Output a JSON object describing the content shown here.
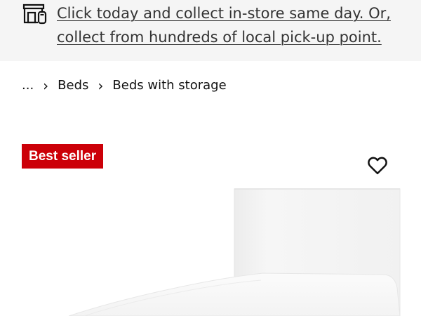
{
  "banner": {
    "icon": "store-pickup-icon",
    "text": "Click today and collect in-store same day. Or, collect from hundreds of local pick-up point."
  },
  "breadcrumb": {
    "items": [
      {
        "label": "..."
      },
      {
        "label": "Beds"
      },
      {
        "label": "Beds with storage"
      }
    ],
    "separator_icon": "chevron-right-icon"
  },
  "product": {
    "badge": "Best seller",
    "favorite_icon": "heart-icon",
    "image_icon": "bed-image"
  },
  "colors": {
    "banner_bg": "#f5f5f5",
    "badge_bg": "#cc0008",
    "badge_text": "#ffffff",
    "text": "#111111"
  }
}
